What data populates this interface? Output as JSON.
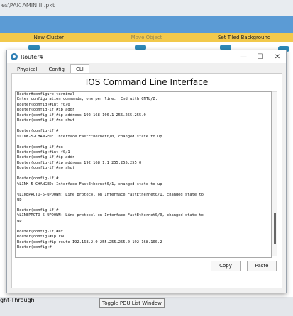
{
  "app": {
    "title_path": "es\\PAK AMIN III.pkt"
  },
  "toolbar": {
    "new_cluster": "New Cluster",
    "move_object": "Move Object",
    "set_tiled_background": "Set Tiled Background"
  },
  "bottom": {
    "connection_type": "ght-Through",
    "toggle_pdu": "Toggle PDU List Window"
  },
  "dialog": {
    "title": "Router4",
    "tabs": [
      "Physical",
      "Config",
      "CLI"
    ],
    "active_tab": "CLI",
    "heading": "IOS Command Line Interface",
    "copy_label": "Copy",
    "paste_label": "Paste",
    "terminal_lines": [
      "Router#configure terminal",
      "Enter configuration commands, one per line.  End with CNTL/Z.",
      "Router(config)#int f0/0",
      "Router(config-if)#ip addr",
      "Router(config-if)#ip address 192.168.100.1 255.255.255.0",
      "Router(config-if)#no shut",
      "",
      "Router(config-if)#",
      "%LINK-5-CHANGED: Interface FastEthernet0/0, changed state to up",
      "",
      "Router(config-if)#ex",
      "Router(config)#int f0/1",
      "Router(config-if)#ip addr",
      "Router(config-if)#ip address 192.168.1.1 255.255.255.0",
      "Router(config-if)#no shut",
      "",
      "Router(config-if)#",
      "%LINK-5-CHANGED: Interface FastEthernet0/1, changed state to up",
      "",
      "%LINEPROTO-5-UPDOWN: Line protocol on Interface FastEthernet0/1, changed state to",
      "up",
      "",
      "Router(config-if)#",
      "%LINEPROTO-5-UPDOWN: Line protocol on Interface FastEthernet0/0, changed state to",
      "up",
      "",
      "Router(config-if)#ex",
      "Router(config)#ip rou",
      "Router(config)#ip route 192.168.2.0 255.255.255.0 192.168.100.2",
      "Router(config)#"
    ]
  }
}
